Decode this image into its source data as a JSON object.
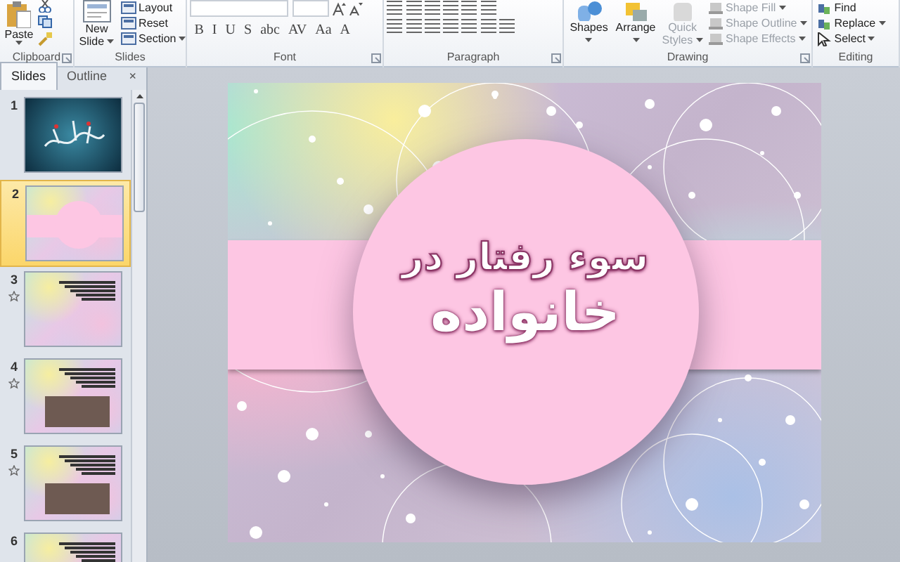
{
  "ribbon": {
    "groups": [
      {
        "kind": "clipboard",
        "label": "Clipboard",
        "paste": "Paste"
      },
      {
        "kind": "slides",
        "label": "Slides",
        "new_slide": [
          "New",
          "Slide"
        ],
        "buttons": [
          "Layout",
          "Reset",
          "Section"
        ]
      },
      {
        "kind": "font",
        "label": "Font",
        "format_buttons": [
          "B",
          "I",
          "U",
          "S",
          "abc",
          "AV",
          "Aa",
          "A"
        ]
      },
      {
        "kind": "paragraph",
        "label": "Paragraph"
      },
      {
        "kind": "drawing",
        "label": "Drawing",
        "large_buttons": [
          {
            "label": "Shapes",
            "disabled": false
          },
          {
            "label": "Arrange",
            "disabled": false
          },
          {
            "label": "Quick Styles",
            "disabled": true
          }
        ],
        "buttons": [
          {
            "label": "Shape Fill",
            "disabled": true
          },
          {
            "label": "Shape Outline",
            "disabled": true
          },
          {
            "label": "Shape Effects",
            "disabled": true
          }
        ]
      },
      {
        "kind": "editing",
        "label": "Editing",
        "buttons": [
          "Find",
          "Replace",
          "Select"
        ]
      }
    ]
  },
  "panel": {
    "tabs": [
      {
        "label": "Slides",
        "selected": true
      },
      {
        "label": "Outline",
        "selected": false
      }
    ],
    "close": "×",
    "slides": [
      {
        "number": "1",
        "kind": "image",
        "selected": false,
        "animated": false
      },
      {
        "number": "2",
        "kind": "title",
        "selected": true,
        "animated": false
      },
      {
        "number": "3",
        "kind": "text",
        "selected": false,
        "animated": true
      },
      {
        "number": "4",
        "kind": "photo",
        "selected": false,
        "animated": true
      },
      {
        "number": "5",
        "kind": "photo",
        "selected": false,
        "animated": true
      },
      {
        "number": "6",
        "kind": "text",
        "selected": false,
        "animated": false
      }
    ]
  },
  "slide": {
    "title_line_1": "سوء رفتار در",
    "title_line_2": "خانواده"
  }
}
